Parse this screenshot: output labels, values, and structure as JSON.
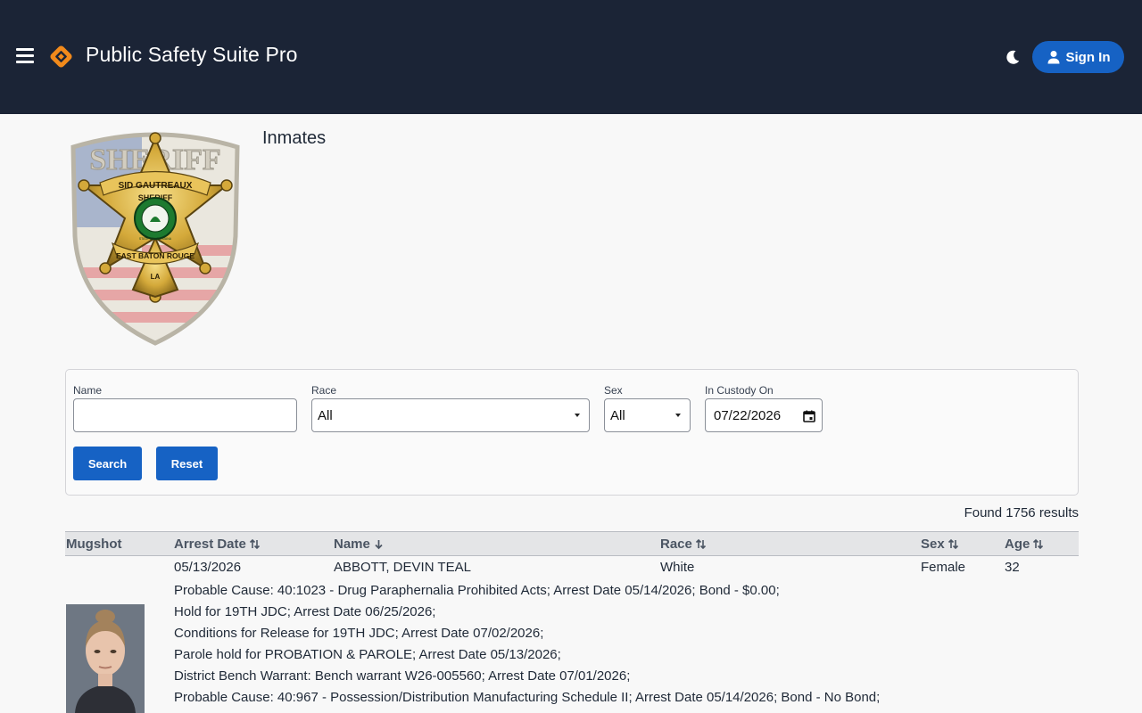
{
  "header": {
    "app_title": "Public Safety Suite Pro",
    "signin_label": "Sign In",
    "bg_color": "#1b2436",
    "accent_color": "#1662c4"
  },
  "page": {
    "title": "Inmates",
    "badge": {
      "top_text": "SHERIFF",
      "name_text": "SID GAUTREAUX",
      "center_text": "SHERIFF",
      "seal_text": "STATE OF LOUISIANA",
      "bottom_text": "EAST BATON ROUGE",
      "tip_text": "LA"
    }
  },
  "filters": {
    "name": {
      "label": "Name",
      "value": ""
    },
    "race": {
      "label": "Race",
      "value": "All"
    },
    "sex": {
      "label": "Sex",
      "value": "All"
    },
    "custody": {
      "label": "In Custody On",
      "value": "07/22/2026"
    },
    "search_label": "Search",
    "reset_label": "Reset"
  },
  "results": {
    "summary": "Found 1756 results"
  },
  "table": {
    "columns": [
      "Mugshot",
      "Arrest Date",
      "Name",
      "Race",
      "Sex",
      "Age"
    ],
    "rows": [
      {
        "arrest_date": "05/13/2026",
        "name": "ABBOTT, DEVIN TEAL",
        "race": "White",
        "sex": "Female",
        "age": "32",
        "charges": [
          "Probable Cause: 40:1023 - Drug Paraphernalia Prohibited Acts; Arrest Date 05/14/2026; Bond - $0.00;",
          "Hold for 19TH JDC; Arrest Date 06/25/2026;",
          "Conditions for Release for 19TH JDC; Arrest Date 07/02/2026;",
          "Parole hold for PROBATION & PAROLE; Arrest Date 05/13/2026;",
          "District Bench Warrant: Bench warrant W26-005560; Arrest Date 07/01/2026;",
          "Probable Cause: 40:967 - Possession/Distribution Manufacturing Schedule II; Arrest Date 05/14/2026; Bond - No Bond;"
        ]
      }
    ]
  },
  "icons": {
    "menu": "hamburger-menu-icon",
    "logo": "diamond-logo-icon",
    "theme": "moon-icon",
    "user": "user-icon",
    "sort": "sort-icon",
    "sort_desc": "arrow-down-icon",
    "calendar": "calendar-icon"
  }
}
